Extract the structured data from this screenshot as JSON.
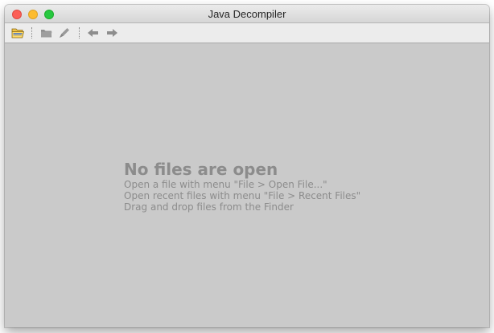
{
  "window": {
    "title": "Java Decompiler"
  },
  "toolbar": {
    "items": [
      {
        "name": "open-file",
        "icon": "open-folder-icon"
      },
      {
        "name": "open-type",
        "icon": "open-type-icon"
      },
      {
        "name": "search",
        "icon": "search-brush-icon"
      },
      {
        "name": "back",
        "icon": "arrow-left-icon"
      },
      {
        "name": "forward",
        "icon": "arrow-right-icon"
      }
    ]
  },
  "main": {
    "title": "No files are open",
    "lines": [
      "Open a file with menu \"File > Open File...\"",
      "Open recent files with menu \"File > Recent Files\"",
      "Drag and drop files from the Finder"
    ]
  },
  "colors": {
    "background": "#cacaca",
    "message_text": "#8c8c8c",
    "close": "#fc5f57",
    "minimize": "#fdbc2e",
    "maximize": "#27c840"
  }
}
